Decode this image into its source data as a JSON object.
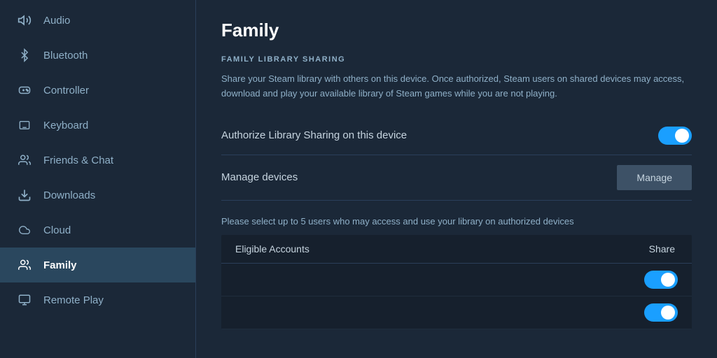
{
  "sidebar": {
    "items": [
      {
        "id": "audio",
        "label": "Audio",
        "icon": "audio"
      },
      {
        "id": "bluetooth",
        "label": "Bluetooth",
        "icon": "bluetooth"
      },
      {
        "id": "controller",
        "label": "Controller",
        "icon": "controller"
      },
      {
        "id": "keyboard",
        "label": "Keyboard",
        "icon": "keyboard"
      },
      {
        "id": "friends-chat",
        "label": "Friends & Chat",
        "icon": "friends"
      },
      {
        "id": "downloads",
        "label": "Downloads",
        "icon": "downloads"
      },
      {
        "id": "cloud",
        "label": "Cloud",
        "icon": "cloud"
      },
      {
        "id": "family",
        "label": "Family",
        "icon": "family",
        "active": true
      },
      {
        "id": "remote-play",
        "label": "Remote Play",
        "icon": "remote-play"
      }
    ]
  },
  "main": {
    "page_title": "Family",
    "section_title": "FAMILY LIBRARY SHARING",
    "description": "Share your Steam library with others on this device. Once authorized, Steam users on shared devices may access, download and play your available library of Steam games while you are not playing.",
    "authorize_label": "Authorize Library Sharing on this device",
    "authorize_enabled": true,
    "manage_label": "Manage devices",
    "manage_button": "Manage",
    "eligible_desc": "Please select up to 5 users who may access and use your library on authorized devices",
    "eligible_header_label": "Eligible Accounts",
    "eligible_header_share": "Share",
    "eligible_rows": [
      {
        "share": true
      },
      {
        "share": true
      }
    ]
  }
}
